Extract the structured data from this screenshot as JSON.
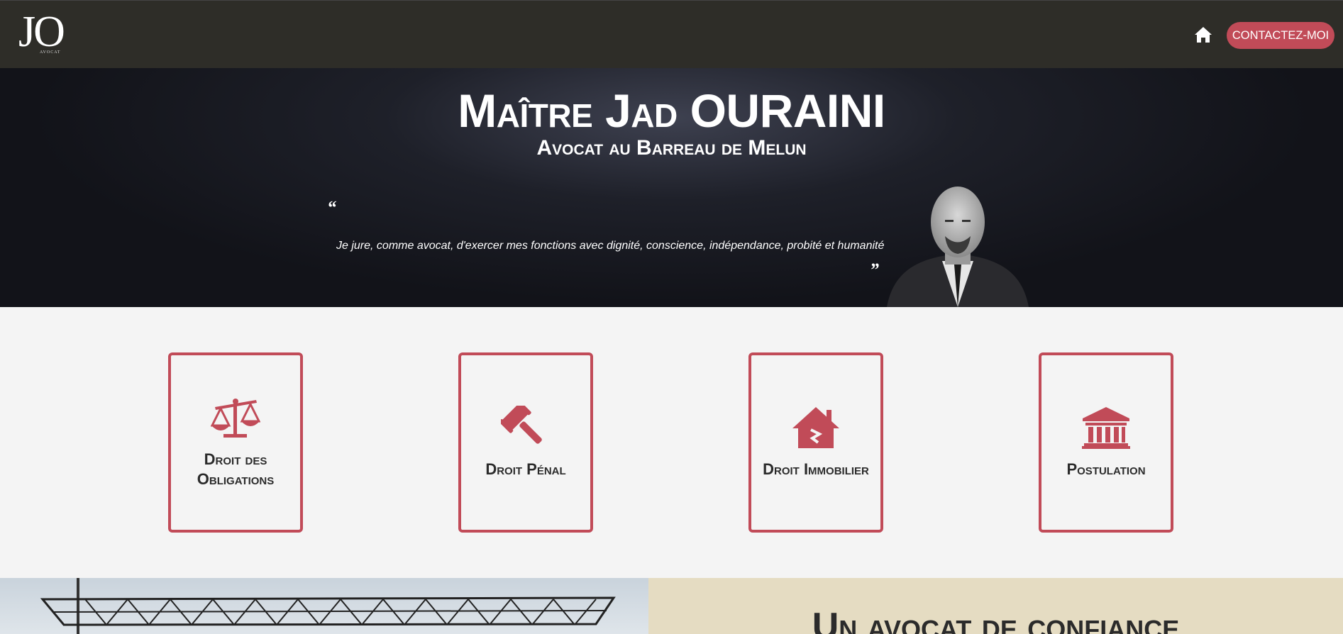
{
  "nav": {
    "logo_mark": "JO",
    "logo_sub": "AVOCAT",
    "home_icon": "home-icon",
    "contact_label": "CONTACTEZ-MOI",
    "colors": {
      "background": "#2e2d28",
      "accent": "#c14b58"
    }
  },
  "hero": {
    "title": "Maître Jad OURAINI",
    "subtitle": "Avocat au Barreau de Melun",
    "quote_open": "“",
    "quote_text": "Je jure, comme avocat, d'exercer mes fonctions avec dignité, conscience, indépendance, probité et humanité",
    "quote_close": "”"
  },
  "services": {
    "cards": [
      {
        "icon": "scale-icon",
        "label": "Droit des Obligations"
      },
      {
        "icon": "gavel-icon",
        "label": "Droit Pénal"
      },
      {
        "icon": "house-icon",
        "label": "Droit Immobilier"
      },
      {
        "icon": "courthouse-icon",
        "label": "Postulation"
      }
    ]
  },
  "about": {
    "heading": "Un avocat de confiance"
  }
}
